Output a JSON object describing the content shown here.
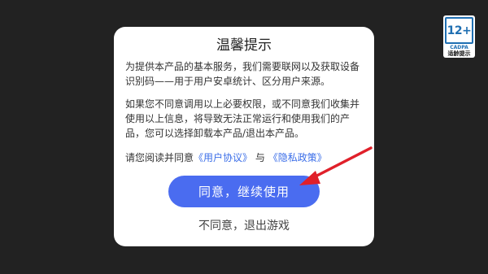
{
  "age_rating": {
    "number": "12+",
    "org": "CADPA",
    "label": "适龄提示"
  },
  "dialog": {
    "title": "温馨提示",
    "paragraph1": "为提供本产品的基本服务，我们需要联网以及获取设备识别码——用于用户安卓统计、区分用户来源。",
    "paragraph2": "如果您不同意调用以上必要权限，或不同意我们收集并使用以上信息，将导致无法正常运行和使用我们的产品，您可以选择卸载本产品/退出本产品。",
    "consent_prefix": "请您阅读并同意",
    "user_agreement_link": "《用户协议》",
    "consent_and": "与",
    "privacy_policy_link": "《隐私政策》",
    "agree_label": "同意，继续使用",
    "disagree_label": "不同意，退出游戏"
  },
  "colors": {
    "accent": "#4a6cf0",
    "link": "#3b6ee8",
    "arrow": "#e0202a",
    "background": "#222222"
  }
}
